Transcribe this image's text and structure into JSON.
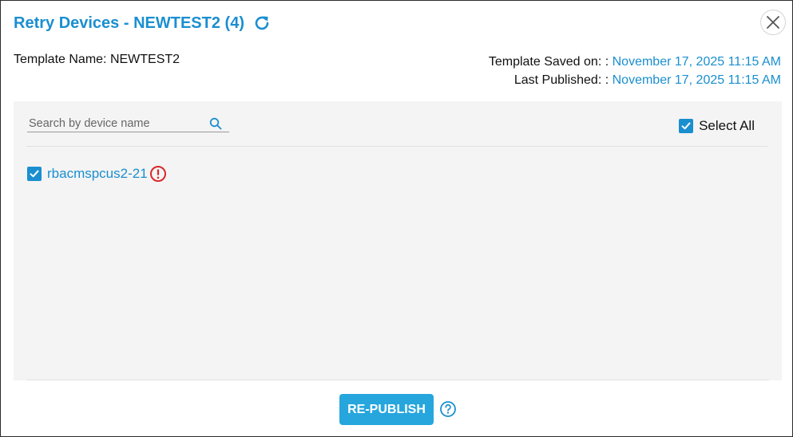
{
  "header": {
    "title": "Retry Devices - NEWTEST2 (4)",
    "refresh_icon": "refresh-icon",
    "close_icon": "close-icon"
  },
  "meta": {
    "template_name_label": "Template Name: NEWTEST2",
    "saved_label": "Template Saved on: : ",
    "saved_value": "November 17, 2025 11:15 AM",
    "published_label": "Last Published: : ",
    "published_value": "November 17, 2025 11:15 AM"
  },
  "search": {
    "placeholder": "Search by device name",
    "value": ""
  },
  "select_all": {
    "label": "Select All",
    "checked": true
  },
  "devices": [
    {
      "name": "rbacmspcus2-21",
      "checked": true,
      "status_icon": "warning-icon"
    }
  ],
  "footer": {
    "republish_label": "RE-PUBLISH",
    "help_icon": "help-icon"
  },
  "colors": {
    "accent": "#1a8fd0",
    "button": "#26a6dd",
    "warning": "#d9282b",
    "panel_bg": "#f4f4f4"
  }
}
